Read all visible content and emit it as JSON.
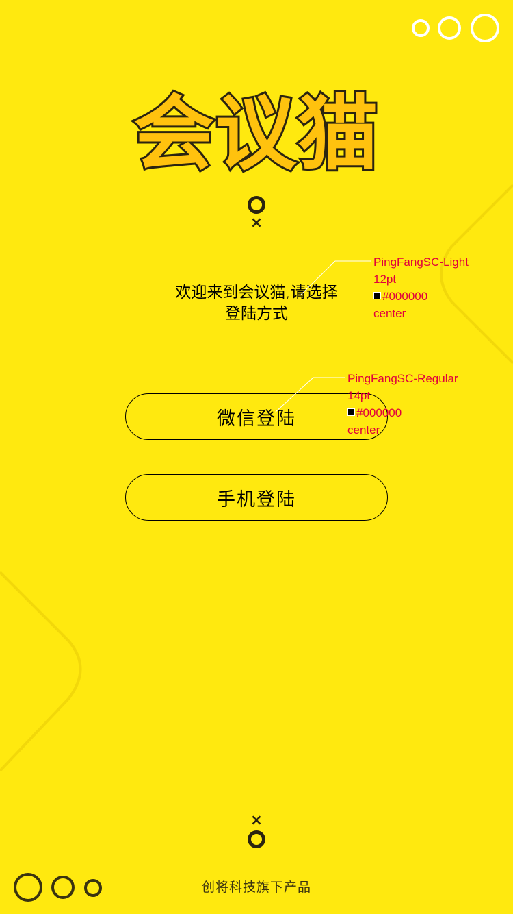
{
  "app": {
    "logo_text": "会议猫",
    "welcome_line1": "欢迎来到会议猫,请选择",
    "welcome_line2": "登陆方式",
    "footer_text": "创将科技旗下产品"
  },
  "buttons": {
    "wechat_label": "微信登陆",
    "phone_label": "手机登陆"
  },
  "marks": {
    "cross": "×"
  },
  "annotations": {
    "welcome": {
      "font": "PingFangSC-Light",
      "size": "12pt",
      "color": "#000000",
      "align": "center"
    },
    "button": {
      "font": "PingFangSC-Regular",
      "size": "14pt",
      "color": "#000000",
      "align": "center"
    }
  },
  "colors": {
    "background": "#FFE90F",
    "logo_fill": "#FFC20E",
    "dark": "#2b2410",
    "annotation": "#E0003C"
  },
  "icons": {
    "top_circles": "ring-icon",
    "bottom_circles": "ring-icon"
  }
}
